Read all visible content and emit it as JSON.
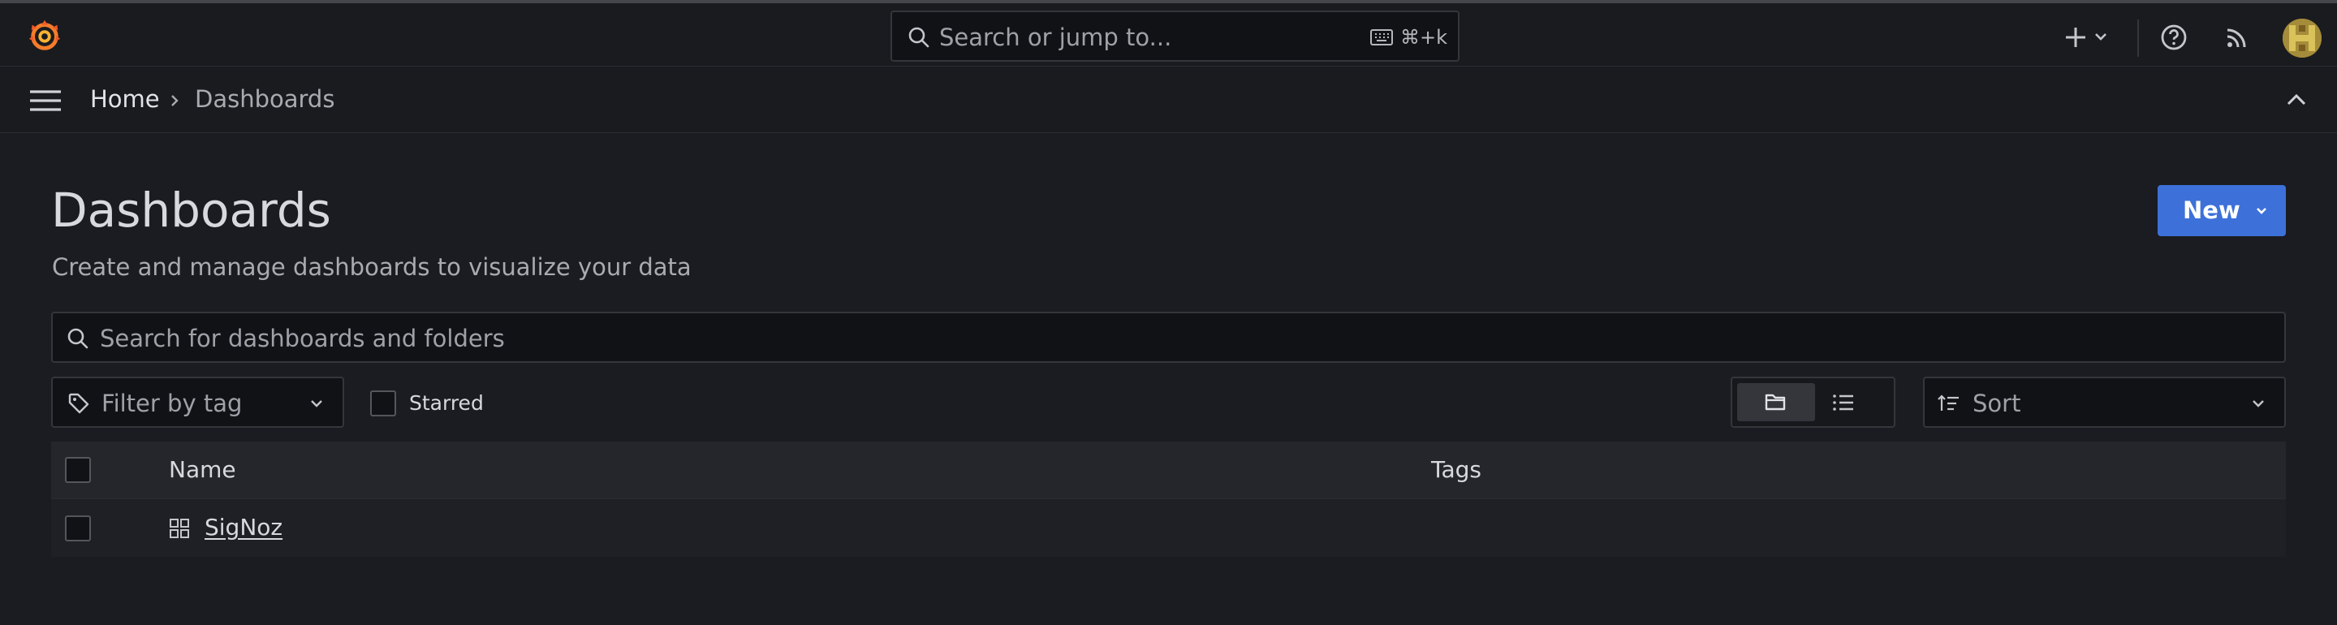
{
  "topbar": {
    "search_placeholder": "Search or jump to...",
    "search_shortcut": "⌘+k",
    "icons": [
      "grafana-logo-icon",
      "search-icon",
      "keyboard-icon",
      "plus-icon",
      "chevron-down-icon",
      "help-icon",
      "rss-icon",
      "avatar"
    ]
  },
  "breadcrumb": {
    "home": "Home",
    "current": "Dashboards"
  },
  "page": {
    "title": "Dashboards",
    "subtitle": "Create and manage dashboards to visualize your data",
    "new_button": "New"
  },
  "filters": {
    "search_placeholder": "Search for dashboards and folders",
    "tag_filter_placeholder": "Filter by tag",
    "starred_label": "Starred",
    "starred_checked": false,
    "view_mode": "folders",
    "sort_placeholder": "Sort"
  },
  "table": {
    "columns": [
      "Name",
      "Tags"
    ],
    "rows": [
      {
        "name": "SigNoz",
        "tags": "",
        "type": "dashboard",
        "checked": false
      }
    ]
  },
  "colors": {
    "background": "#1b1c21",
    "accent": "#3d71d9",
    "logo_orange": "#f05a28"
  }
}
